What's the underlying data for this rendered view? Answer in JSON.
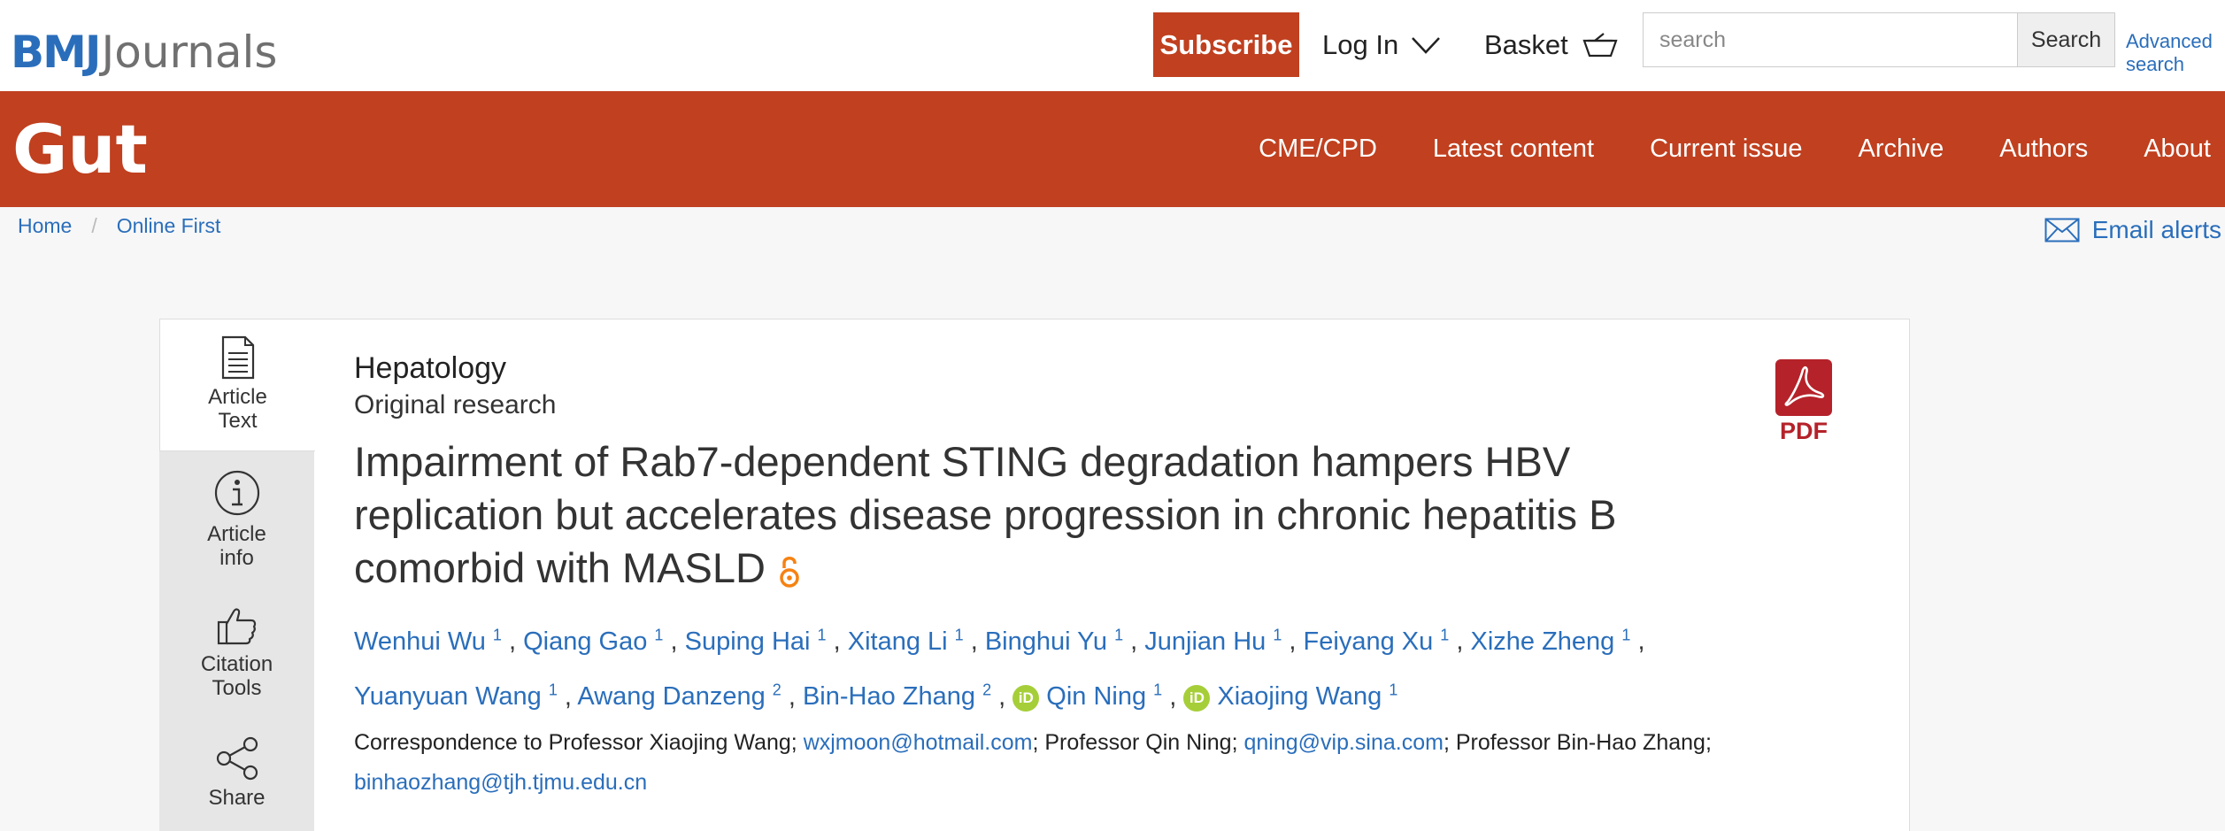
{
  "header": {
    "logo_bmj": "BMJ",
    "logo_journals": "Journals",
    "subscribe_label": "Subscribe",
    "login_label": "Log In",
    "basket_label": "Basket",
    "search_placeholder": "search",
    "search_button": "Search",
    "advanced_search_line1": "Advanced",
    "advanced_search_line2": "search"
  },
  "journal": {
    "title": "Gut",
    "nav": [
      "CME/CPD",
      "Latest content",
      "Current issue",
      "Archive",
      "Authors",
      "About"
    ]
  },
  "breadcrumb": {
    "home": "Home",
    "separator": "/",
    "current": "Online First"
  },
  "email_alerts": "Email alerts",
  "sidetabs": [
    {
      "line1": "Article",
      "line2": "Text",
      "icon": "document-icon"
    },
    {
      "line1": "Article",
      "line2": "info",
      "icon": "info-icon"
    },
    {
      "line1": "Citation",
      "line2": "Tools",
      "icon": "thumbs-up-icon"
    },
    {
      "line1": "Share",
      "line2": "",
      "icon": "share-icon"
    }
  ],
  "article": {
    "subject": "Hepatology",
    "type": "Original research",
    "title": "Impairment of Rab7-dependent STING degradation hampers HBV replication but accelerates disease progression in chronic hepatitis B comorbid with MASLD",
    "authors": [
      {
        "name": "Wenhui Wu",
        "aff": "1",
        "orcid": false
      },
      {
        "name": "Qiang Gao",
        "aff": "1",
        "orcid": false
      },
      {
        "name": "Suping Hai",
        "aff": "1",
        "orcid": false
      },
      {
        "name": "Xitang Li",
        "aff": "1",
        "orcid": false
      },
      {
        "name": "Binghui Yu",
        "aff": "1",
        "orcid": false
      },
      {
        "name": "Junjian Hu",
        "aff": "1",
        "orcid": false
      },
      {
        "name": "Feiyang Xu",
        "aff": "1",
        "orcid": false
      },
      {
        "name": "Xizhe Zheng",
        "aff": "1",
        "orcid": false
      },
      {
        "name": "Yuanyuan Wang",
        "aff": "1",
        "orcid": false
      },
      {
        "name": "Awang Danzeng",
        "aff": "2",
        "orcid": false
      },
      {
        "name": "Bin-Hao Zhang",
        "aff": "2",
        "orcid": false
      },
      {
        "name": "Qin Ning",
        "aff": "1",
        "orcid": true
      },
      {
        "name": "Xiaojing Wang",
        "aff": "1",
        "orcid": true
      }
    ],
    "orcid_badge": "iD",
    "correspondence": {
      "prefix": "Correspondence to Professor Xiaojing Wang;",
      "email1": "wxjmoon@hotmail.com",
      "middle1": "; Professor Qin Ning;",
      "email2": "qning@vip.sina.com",
      "middle2": "; Professor Bin-Hao Zhang;",
      "email3": "binhaozhang@tjh.tjmu.edu.cn"
    },
    "pdf_label": "PDF"
  },
  "colors": {
    "brand_red": "#c0401f",
    "link_blue": "#2a6ebb",
    "orcid_green": "#a6ce39",
    "oa_orange": "#f68212",
    "pdf_red": "#b5222a"
  }
}
